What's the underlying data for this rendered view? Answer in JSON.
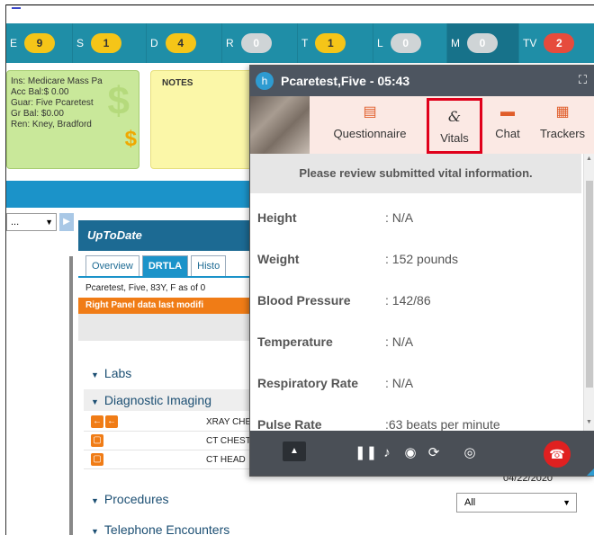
{
  "status_bar": [
    {
      "label": "E",
      "count": "9",
      "color": "yellow"
    },
    {
      "label": "S",
      "count": "1",
      "color": "yellow"
    },
    {
      "label": "D",
      "count": "4",
      "color": "yellow"
    },
    {
      "label": "R",
      "count": "0",
      "color": "gray"
    },
    {
      "label": "T",
      "count": "1",
      "color": "yellow"
    },
    {
      "label": "L",
      "count": "0",
      "color": "gray"
    },
    {
      "label": "M",
      "count": "0",
      "color": "gray"
    },
    {
      "label": "TV",
      "count": "2",
      "color": "red"
    }
  ],
  "insurance": {
    "line1": "Ins: Medicare Mass Pa",
    "line2": "Acc Bal:$ 0.00",
    "line3": "Guar: Five Pcaretest",
    "line4": "Gr Bal: $0.00",
    "line5": "Ren: Kney, Bradford"
  },
  "notes": {
    "title": "NOTES"
  },
  "left_dropdown": {
    "value": "..."
  },
  "uptodate": {
    "title": "UpToDate",
    "tabs": [
      "Overview",
      "DRTLA",
      "Histo"
    ],
    "patient": "Pcaretest, Five, 83Y, F as of 0",
    "notice": "Right Panel data last modifi"
  },
  "sections": {
    "labs": "Labs",
    "diagnostic_imaging": "Diagnostic Imaging",
    "procedures": "Procedures",
    "telephone": "Telephone Encounters"
  },
  "imaging_rows": [
    {
      "name": "XRAY CHE"
    },
    {
      "name": "CT CHEST"
    },
    {
      "name": "CT HEAD"
    }
  ],
  "procedures_filter": {
    "value": "All"
  },
  "date_fragment": "04/22/2020",
  "video_popup": {
    "title": "Pcaretest,Five - 05:43",
    "tools": [
      "Questionnaire",
      "Vitals",
      "Chat",
      "Trackers"
    ],
    "banner": "Please review submitted vital information.",
    "vitals": [
      {
        "label": "Height",
        "value": ": N/A"
      },
      {
        "label": "Weight",
        "value": ": 152 pounds"
      },
      {
        "label": "Blood Pressure",
        "value": ": 142/86"
      },
      {
        "label": "Temperature",
        "value": ": N/A"
      },
      {
        "label": "Respiratory Rate",
        "value": ": N/A"
      },
      {
        "label": "Pulse Rate",
        "value": ":63 beats per minute"
      }
    ]
  },
  "colors": {
    "status_bar": "#1f8ea7",
    "popup_header": "#4d5560",
    "tools_bg": "#fbe9e4",
    "vitals_highlight": "#e0001b",
    "end_call": "#e02020",
    "orange_accent": "#f07c16"
  },
  "icons": {
    "questionnaire": "clipboard-icon",
    "vitals": "stethoscope-icon",
    "chat": "chat-bubble-icon",
    "trackers": "chart-icon",
    "end_call": "phone-hangup-icon"
  }
}
